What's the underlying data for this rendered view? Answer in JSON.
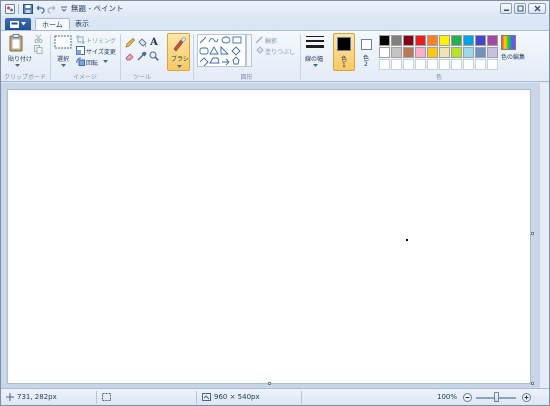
{
  "window": {
    "title": "無題 - ペイント"
  },
  "qat": {
    "save_icon": "save-icon",
    "undo_icon": "undo-icon",
    "redo_icon": "redo-icon"
  },
  "tabs": {
    "home": "ホーム",
    "view": "表示"
  },
  "clipboard": {
    "paste": "貼り付け",
    "group": "クリップボード"
  },
  "image": {
    "select": "選択",
    "crop": "トリミング",
    "resize": "サイズ変更",
    "rotate": "回転",
    "group": "イメージ"
  },
  "tools": {
    "text_tool": "A",
    "group": "ツール"
  },
  "brushes": {
    "label": "ブラシ"
  },
  "shapes": {
    "outline": "輪郭",
    "fill": "塗りつぶし",
    "group": "図形"
  },
  "size": {
    "label": "線の幅"
  },
  "colors": {
    "color1_label": "色",
    "color1_num": "1",
    "color2_label": "色",
    "color2_num": "2",
    "edit_label": "色の編集",
    "group": "色",
    "color1": "#000000",
    "color2": "#ffffff",
    "palette": [
      "#000000",
      "#7f7f7f",
      "#880015",
      "#ed1c24",
      "#ff7f27",
      "#fff200",
      "#22b14c",
      "#00a2e8",
      "#3f48cc",
      "#a349a4",
      "#ffffff",
      "#c3c3c3",
      "#b97a57",
      "#ffaec9",
      "#ffc90e",
      "#efe4b0",
      "#b5e61d",
      "#99d9ea",
      "#7092be",
      "#c8bfe7"
    ],
    "custom_slots": 10
  },
  "status": {
    "cursor": "731, 282px",
    "canvas_size": "960 × 540px",
    "zoom": "100%"
  }
}
